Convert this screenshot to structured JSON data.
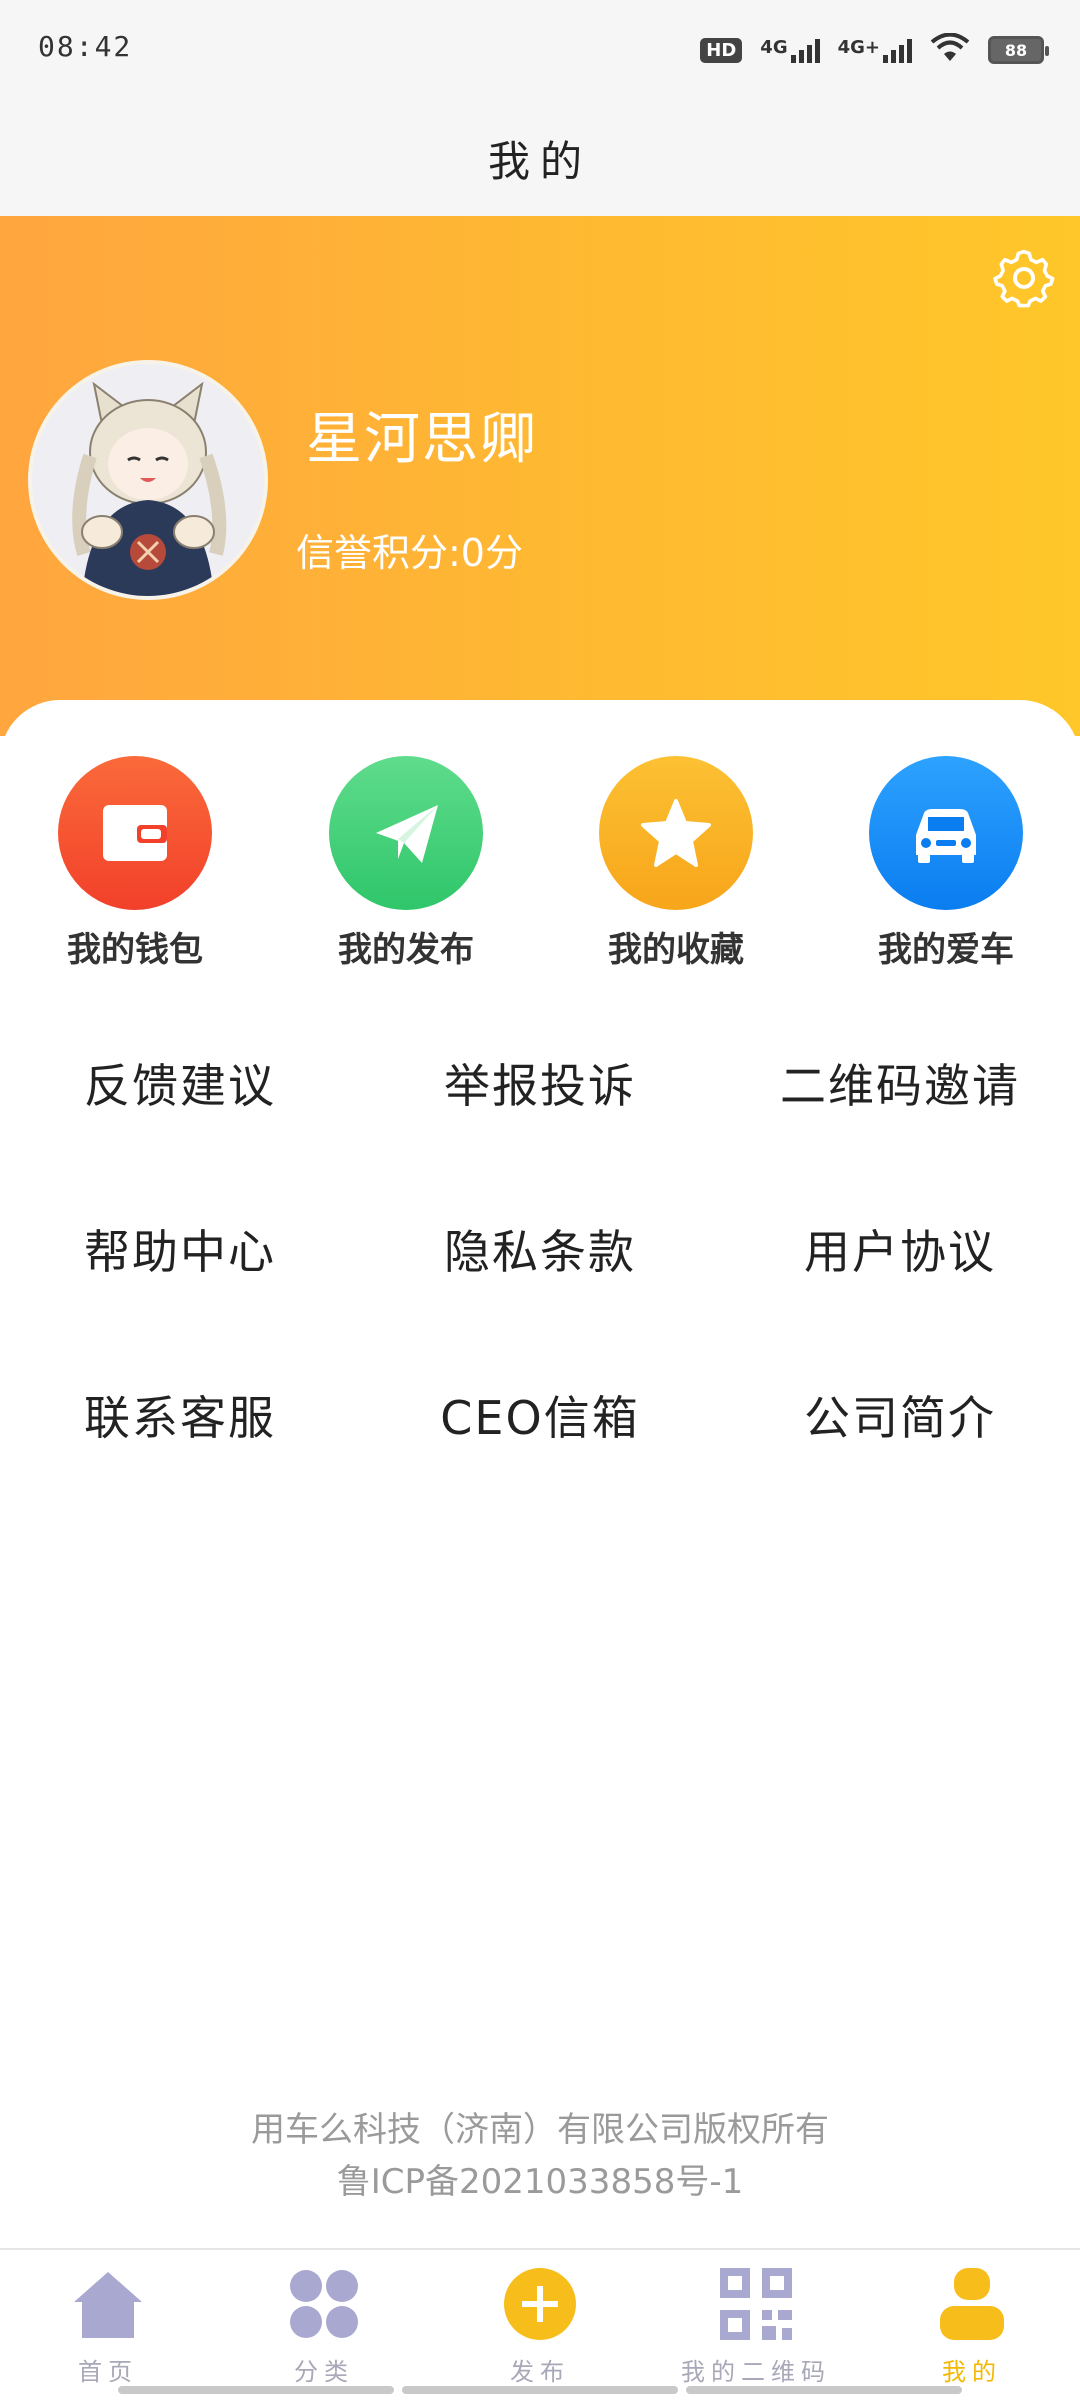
{
  "status_bar": {
    "time": "08:42",
    "hd_label": "HD",
    "net1": "4G",
    "net2": "4G+",
    "battery": "88"
  },
  "title_bar": {
    "title": "我的"
  },
  "profile": {
    "username": "星河思卿",
    "credit_text": "信誉积分:0分"
  },
  "quick_actions": [
    {
      "label": "我的钱包",
      "icon": "wallet-icon",
      "color": "#f5522b"
    },
    {
      "label": "我的发布",
      "icon": "paper-plane-icon",
      "color": "#3ecf74"
    },
    {
      "label": "我的收藏",
      "icon": "star-icon",
      "color": "#fbb31f"
    },
    {
      "label": "我的爱车",
      "icon": "car-icon",
      "color": "#1a8ff5"
    }
  ],
  "menu_rows": [
    [
      "反馈建议",
      "举报投诉",
      "二维码邀请"
    ],
    [
      "帮助中心",
      "隐私条款",
      "用户协议"
    ],
    [
      "联系客服",
      "CEO信箱",
      "公司简介"
    ]
  ],
  "footer": {
    "line1": "用车么科技（济南）有限公司版权所有",
    "line2": "鲁ICP备2021033858号-1"
  },
  "tabbar": [
    {
      "label": "首页",
      "icon": "home-icon",
      "active": false
    },
    {
      "label": "分类",
      "icon": "grid-icon",
      "active": false
    },
    {
      "label": "发布",
      "icon": "plus-circle-icon",
      "active": false
    },
    {
      "label": "我的二维码",
      "icon": "qr-code-icon",
      "active": false
    },
    {
      "label": "我的",
      "icon": "user-icon",
      "active": true
    }
  ],
  "colors": {
    "accent": "#ffb832",
    "tab_active": "#f5b800",
    "tab_inactive": "#a8a8c8"
  }
}
